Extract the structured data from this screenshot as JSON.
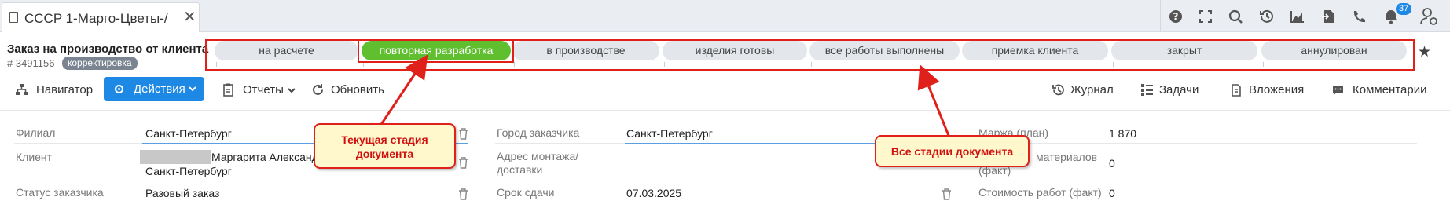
{
  "tab": {
    "title": "CCCP 1-Марго-Цветы-/",
    "close": "✕"
  },
  "notifications": {
    "count": "37"
  },
  "document": {
    "title": "Заказ на производство от клиента",
    "number": "# 3491156",
    "tag": "корректировка"
  },
  "stages": [
    {
      "label": "на расчете",
      "current": false
    },
    {
      "label": "повторная разработка",
      "current": true
    },
    {
      "label": "в производстве",
      "current": false
    },
    {
      "label": "изделия готовы",
      "current": false
    },
    {
      "label": "все работы выполнены",
      "current": false
    },
    {
      "label": "приемка клиента",
      "current": false
    },
    {
      "label": "закрыт",
      "current": false
    },
    {
      "label": "аннулирован",
      "current": false
    }
  ],
  "toolbar": {
    "navigator": "Навигатор",
    "actions": "Действия",
    "reports": "Отчеты",
    "refresh": "Обновить",
    "journal": "Журнал",
    "tasks": "Задачи",
    "attachments": "Вложения",
    "comments": "Комментарии"
  },
  "form": {
    "branch": {
      "label": "Филиал",
      "value": "Санкт-Петербург"
    },
    "client": {
      "label": "Клиент",
      "value_line1": "Маргарита Александ",
      "value_line2": "Санкт-Петербург"
    },
    "client_status": {
      "label": "Статус заказчика",
      "value": "Разовый заказ"
    },
    "customer_city": {
      "label": "Город заказчика",
      "value": "Санкт-Петербург"
    },
    "install_address": {
      "label_line1": "Адрес монтажа/",
      "label_line2": "доставки",
      "value": ""
    },
    "deadline": {
      "label": "Срок сдачи",
      "value": "07.03.2025"
    },
    "margin": {
      "label": "Маржа (план)",
      "value": "1 870"
    },
    "materials": {
      "label": "материалов",
      "label2": "(факт)",
      "value": "0"
    },
    "works_cost": {
      "label": "Стоимость работ (факт)",
      "value": "0"
    }
  },
  "callouts": {
    "current_stage_line1": "Текущая стадия",
    "current_stage_line2": "документа",
    "all_stages": "Все стадии документа"
  },
  "colors": {
    "accent": "#1e88e5",
    "current_stage": "#5fbf2f",
    "annotation": "#e0201a",
    "callout_bg": "#fff8cc"
  }
}
